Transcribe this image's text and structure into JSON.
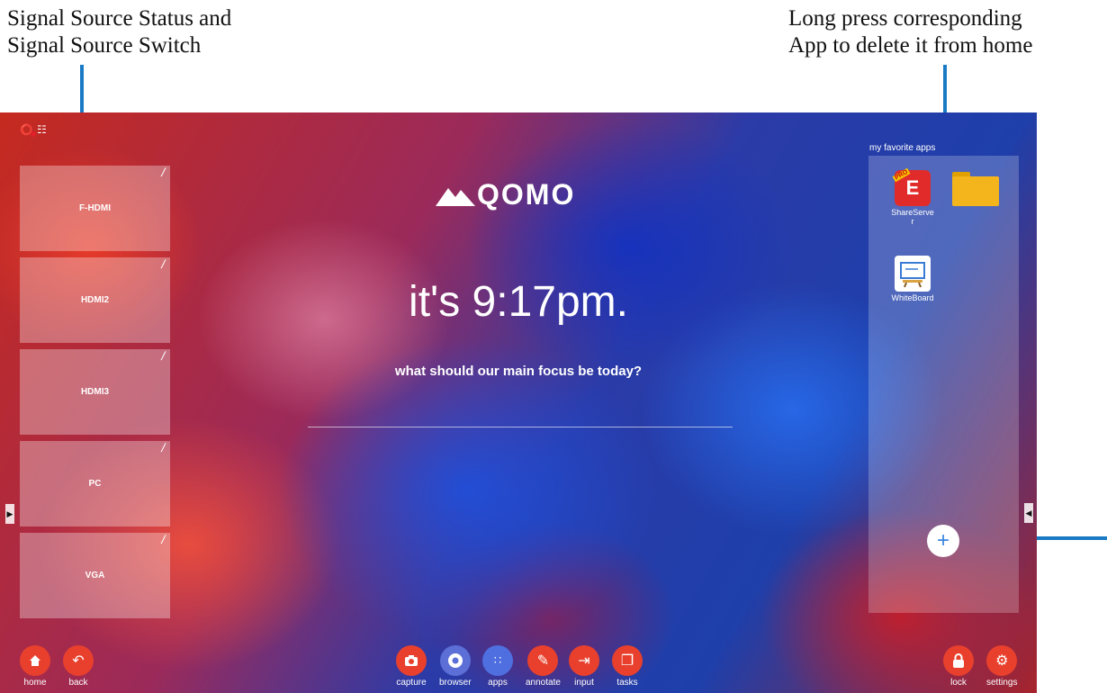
{
  "callouts": {
    "left": [
      "Signal Source Status and",
      "Signal Source Switch"
    ],
    "right": [
      "Long press corresponding",
      "App to delete it from home"
    ]
  },
  "status": {
    "wifi_icon": "wifi-icon",
    "network_icon": "network-icon"
  },
  "sources": [
    {
      "label": "F-HDMI"
    },
    {
      "label": "HDMI2"
    },
    {
      "label": "HDMI3"
    },
    {
      "label": "PC"
    },
    {
      "label": "VGA"
    }
  ],
  "brand": {
    "logo": "QOMO"
  },
  "clock": {
    "text": "it's 9:17pm."
  },
  "focus": {
    "question": "what should our main focus be today?"
  },
  "favorites": {
    "title": "my favorite apps",
    "apps": [
      {
        "label": "ShareServer",
        "badge": "PRO",
        "glyph": "E"
      },
      {
        "label": ""
      },
      {
        "label": "WhiteBoard"
      }
    ],
    "add_glyph": "+"
  },
  "dock": {
    "home": "home",
    "back": "back",
    "capture": "capture",
    "browser": "browser",
    "apps": "apps",
    "annotate": "annotate",
    "input": "input",
    "tasks": "tasks",
    "lock": "lock",
    "settings": "settings"
  },
  "colors": {
    "accent": "#e8402c",
    "pointer": "#1a7bc4"
  }
}
